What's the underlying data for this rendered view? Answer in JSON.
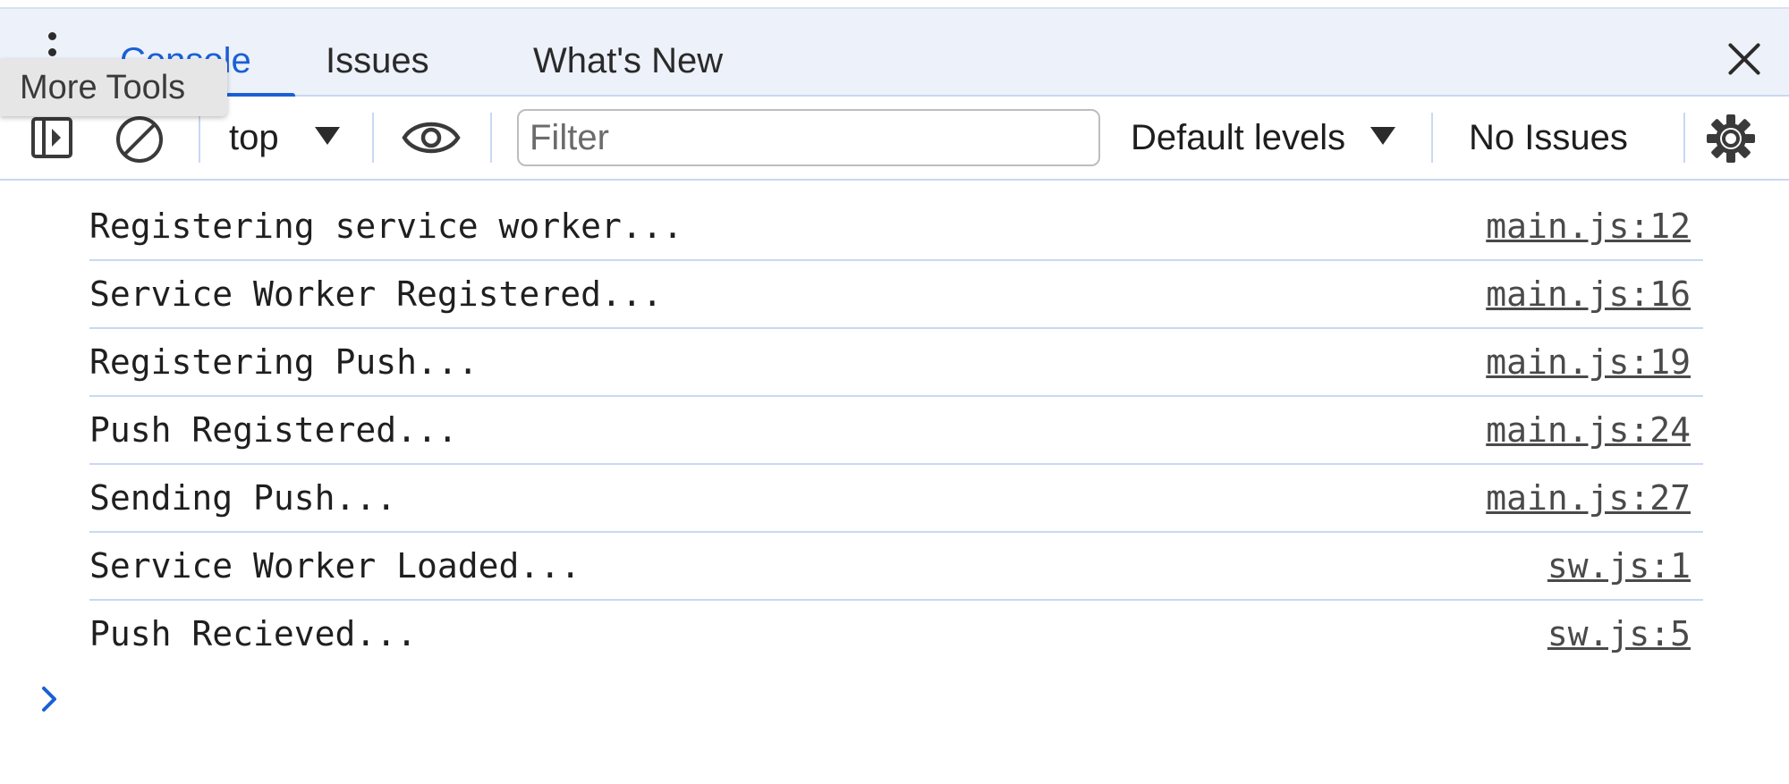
{
  "tabbar": {
    "tabs": [
      {
        "label": "Console",
        "active": true
      },
      {
        "label": "Issues",
        "active": false
      },
      {
        "label": "What's New",
        "active": false
      }
    ]
  },
  "tooltip": {
    "text": "More Tools"
  },
  "toolbar": {
    "context": "top",
    "filter_placeholder": "Filter",
    "filter_value": "",
    "levels": "Default levels",
    "issues": "No Issues"
  },
  "logs": [
    {
      "message": "Registering service worker...",
      "source": "main.js:12"
    },
    {
      "message": "Service Worker Registered...",
      "source": "main.js:16"
    },
    {
      "message": "Registering Push...",
      "source": "main.js:19"
    },
    {
      "message": "Push Registered...",
      "source": "main.js:24"
    },
    {
      "message": "Sending Push...",
      "source": "main.js:27"
    },
    {
      "message": "Service Worker Loaded...",
      "source": "sw.js:1"
    },
    {
      "message": "Push Recieved...",
      "source": "sw.js:5"
    }
  ],
  "colors": {
    "accent": "#1a5fd6",
    "tabbar_bg": "#edf1f9",
    "divider": "#c9d8f3"
  },
  "icons": [
    "more-tools-icon",
    "close-icon",
    "sidebar-toggle-icon",
    "clear-console-icon",
    "dropdown-caret-icon",
    "eye-icon",
    "gear-icon",
    "prompt-chevron-icon"
  ]
}
